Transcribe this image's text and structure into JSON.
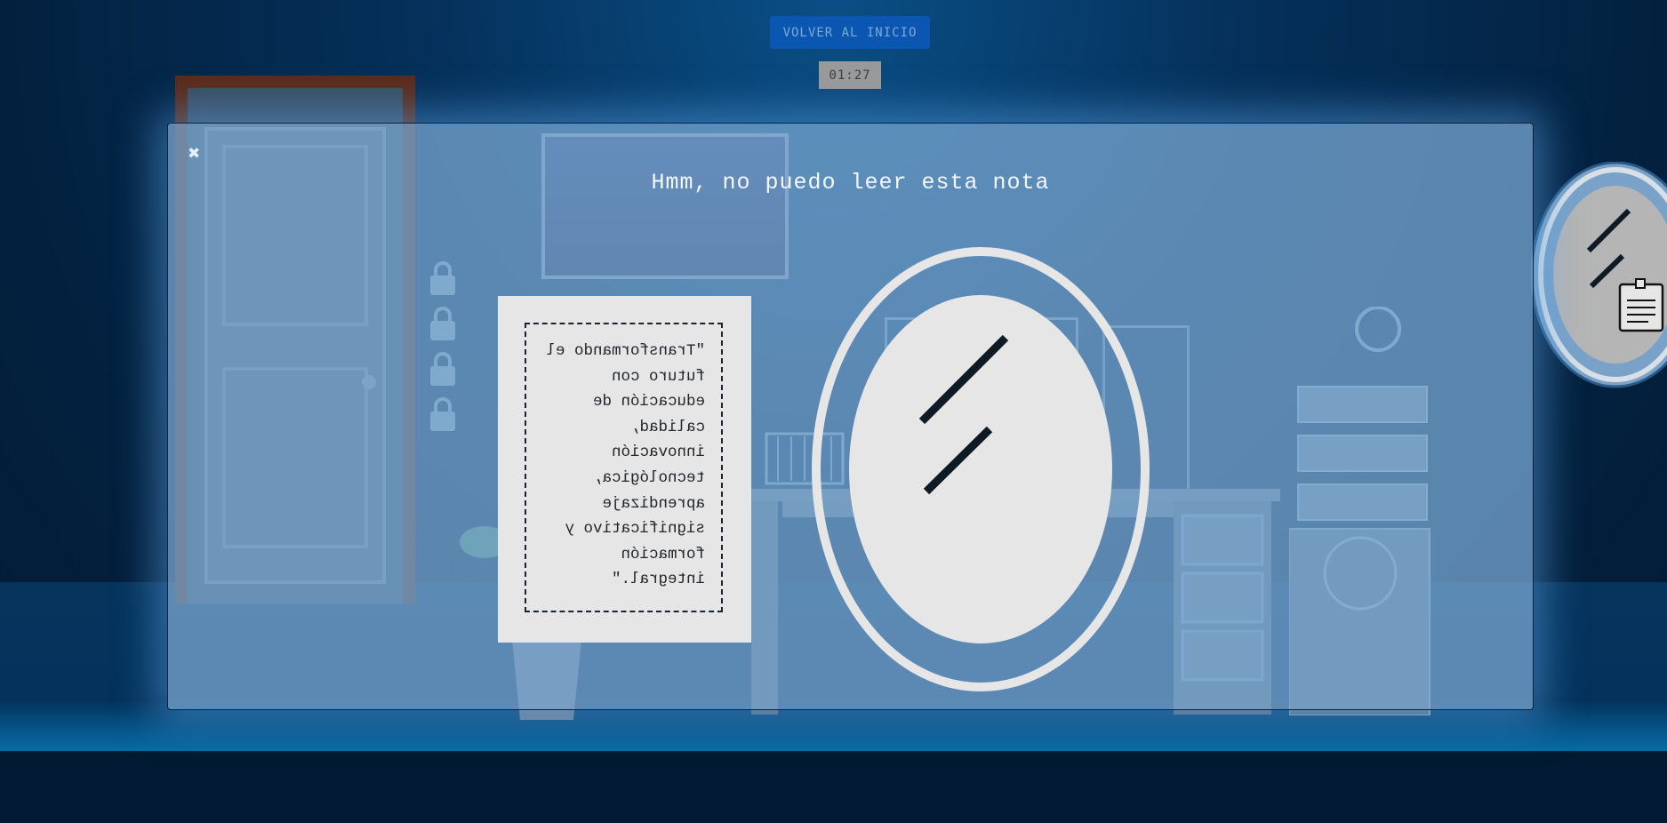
{
  "header": {
    "back_button": "VOLVER AL INICIO",
    "timer": "01:27"
  },
  "modal": {
    "close_symbol": "✖",
    "title": "Hmm, no puedo leer esta nota",
    "note_text": "\"Transformando el futuro con educación de calidad, innovación tecnológica, aprendizaje significativo y formación integral.\""
  },
  "icons": {
    "close": "close-icon",
    "lock": "lock-icon",
    "mirror": "mirror-icon",
    "note": "note-icon"
  },
  "colors": {
    "overlay": "#7caad4",
    "button": "#0a56b0",
    "note_bg": "#e6e6e6",
    "mirror": "#e6e6e6"
  }
}
